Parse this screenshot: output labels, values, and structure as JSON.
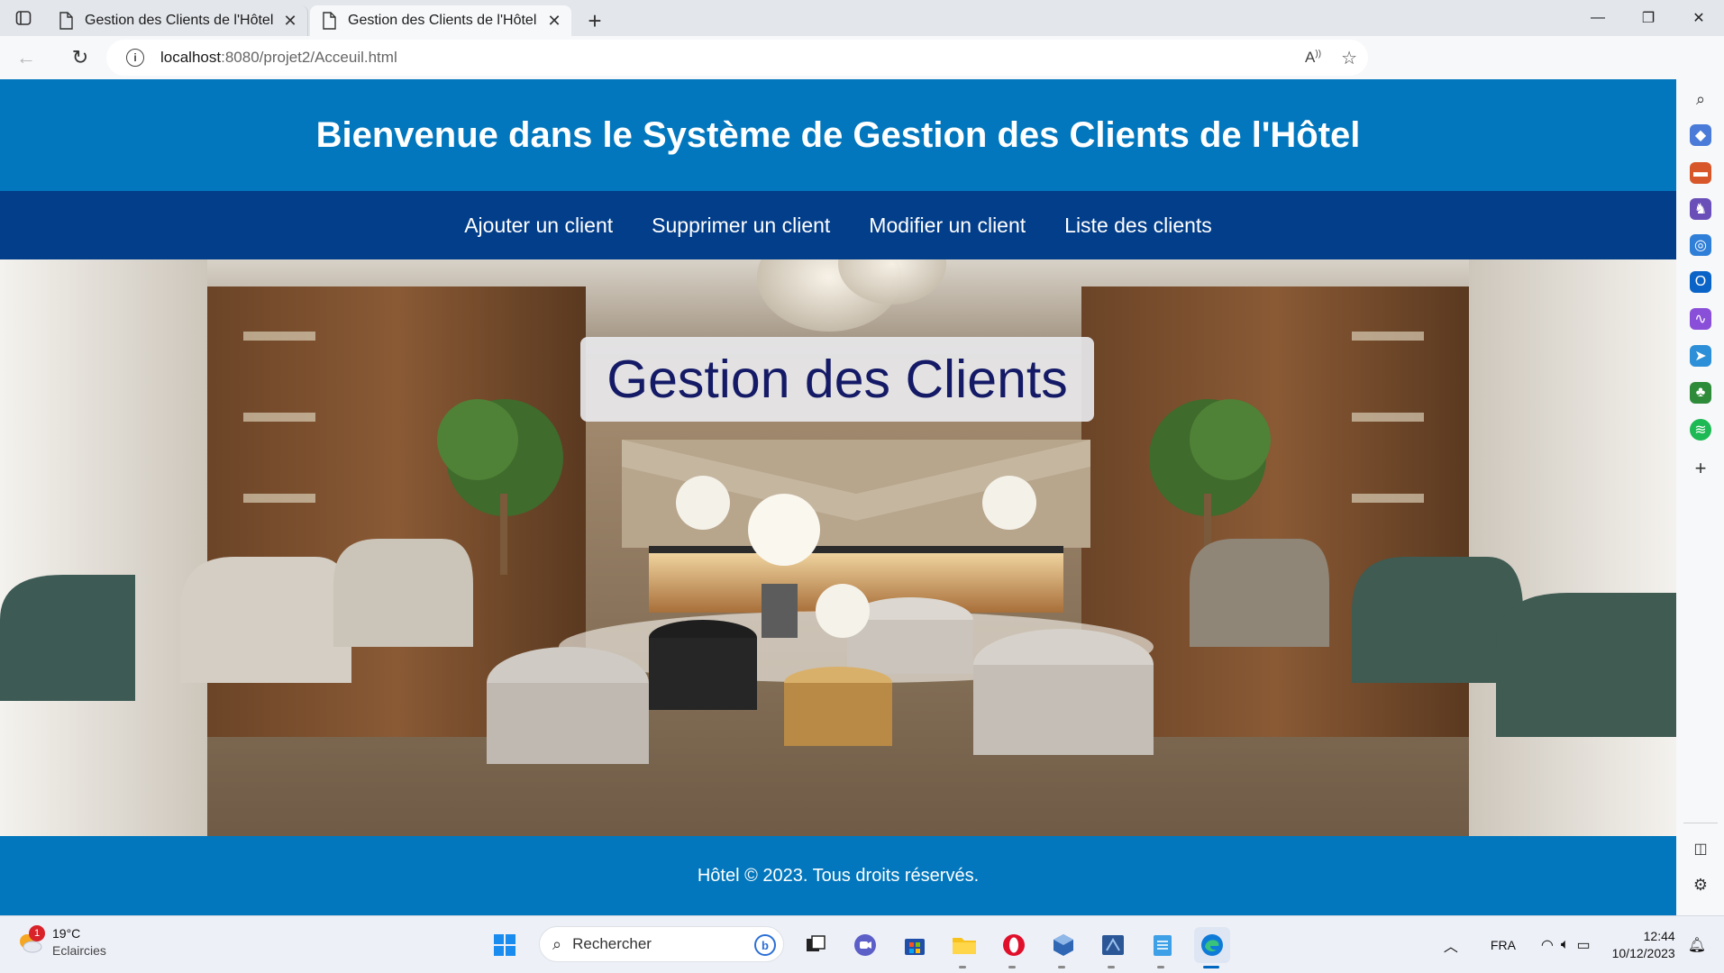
{
  "browser": {
    "tabs": [
      {
        "title": "Gestion des Clients de l'Hôtel",
        "active": false
      },
      {
        "title": "Gestion des Clients de l'Hôtel",
        "active": true
      }
    ],
    "url_host": "localhost",
    "url_rest": ":8080/projet2/Acceuil.html"
  },
  "site": {
    "header_title": "Bienvenue dans le Système de Gestion des Clients de l'Hôtel",
    "nav": [
      "Ajouter un client",
      "Supprimer un client",
      "Modifier un client",
      "Liste des clients"
    ],
    "hero_title": "Gestion des Clients",
    "footer": "Hôtel © 2023. Tous droits réservés."
  },
  "taskbar": {
    "weather_temp": "19°C",
    "weather_desc": "Eclaircies",
    "weather_badge": "1",
    "search_placeholder": "Rechercher",
    "language": "FRA",
    "time": "12:44",
    "date": "10/12/2023"
  },
  "colors": {
    "header_blue": "#0277bd",
    "nav_blue": "#033e8a",
    "hero_title_text": "#141a66"
  }
}
